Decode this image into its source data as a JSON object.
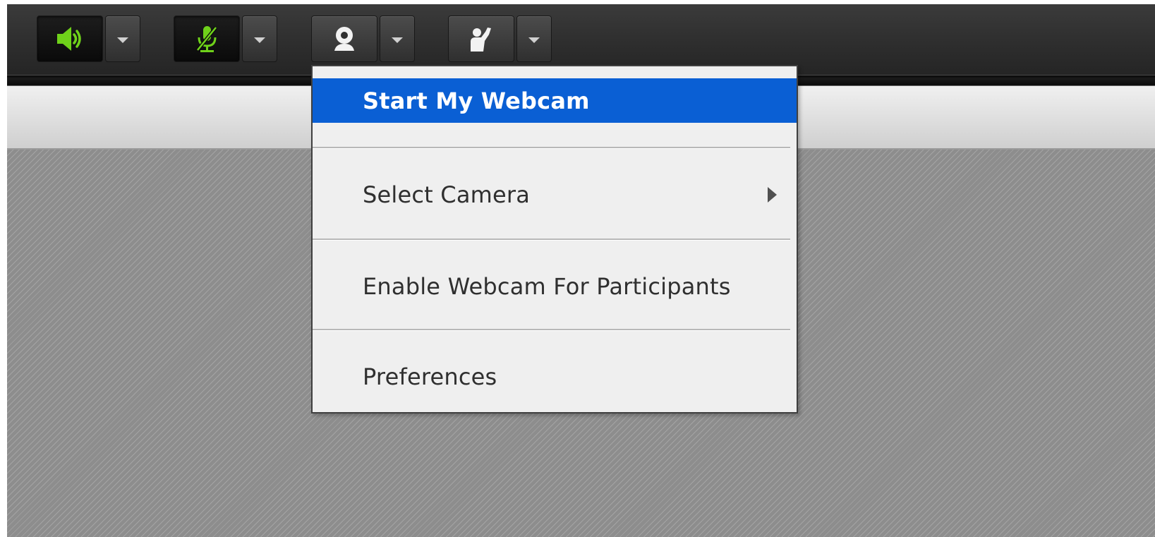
{
  "toolbar": {
    "controls": [
      {
        "name": "speaker",
        "icon": "speaker-volume-icon",
        "active": true,
        "icon_color": "#6fd21a"
      },
      {
        "name": "microphone",
        "icon": "microphone-muted-icon",
        "active": true,
        "icon_color": "#6fd21a"
      },
      {
        "name": "webcam",
        "icon": "webcam-icon",
        "active": false,
        "icon_color": "#f2f2f2"
      },
      {
        "name": "raise-hand",
        "icon": "raise-hand-icon",
        "active": false,
        "icon_color": "#f2f2f2"
      }
    ],
    "dropdown_icon": "caret-down-icon"
  },
  "webcam_menu": {
    "items": [
      {
        "label": "Start My Webcam",
        "highlighted": true
      },
      {
        "label": "Select Camera",
        "has_submenu": true
      },
      {
        "label": "Enable Webcam For Participants"
      },
      {
        "label": "Preferences"
      }
    ],
    "highlight_color": "#0a5fd4"
  },
  "colors": {
    "toolbar_bg": "#2e2e2e",
    "active_icon_green": "#6fd21a",
    "menu_bg": "#efefef",
    "stage_bg": "#8d8d8d"
  }
}
